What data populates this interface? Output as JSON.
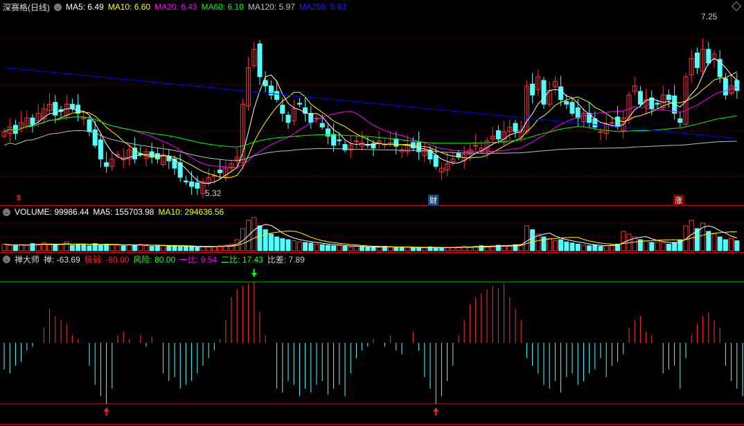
{
  "header": {
    "title": "深赛格(日线)",
    "ma5": "MA5: 6.49",
    "ma10": "MA10: 6.60",
    "ma20": "MA20: 6.43",
    "ma60": "MA60: 6.10",
    "ma120": "MA120: 5.97",
    "ma250": "MA250: 5.93"
  },
  "volume_header": {
    "volume": "VOLUME: 99986.44",
    "ma5": "MA5: 155703.98",
    "ma10": "MA10: 294636.56"
  },
  "indicator_header": {
    "name": "禅大师",
    "chan": "禅: -63.69",
    "jiruo": "极弱: -80.00",
    "fengxian": "风险: 80.00",
    "yibi": "一比: 9.54",
    "erbi": "二比: 17.43",
    "bicha": "比差: 7.89"
  },
  "labels": {
    "high": "7.25",
    "low": "5.32",
    "marker_s": "$",
    "marker_cai": "财",
    "marker_zhang": "涨"
  },
  "colors": {
    "up": "#ff3232",
    "down": "#54fcfc",
    "ma5": "#ffffff",
    "ma10": "#ffff00",
    "ma20": "#ff00ff",
    "ma60": "#00ff00",
    "ma120": "#c0c0c0",
    "ma250": "#0000ff"
  },
  "chart_data": {
    "type": "candlestick",
    "close": [
      6.0,
      6.05,
      5.98,
      6.1,
      6.15,
      6.08,
      6.2,
      6.25,
      6.3,
      6.18,
      6.22,
      6.3,
      6.25,
      6.2,
      6.15,
      6.0,
      5.85,
      5.7,
      5.62,
      5.7,
      5.75,
      5.72,
      5.8,
      5.7,
      5.75,
      5.78,
      5.72,
      5.7,
      5.75,
      5.68,
      5.6,
      5.5,
      5.45,
      5.4,
      5.38,
      5.45,
      5.5,
      5.52,
      5.55,
      5.6,
      5.65,
      5.72,
      6.3,
      6.7,
      6.9,
      6.6,
      6.5,
      6.4,
      6.35,
      6.2,
      6.1,
      6.25,
      6.3,
      6.2,
      6.1,
      6.15,
      6.05,
      5.95,
      5.85,
      5.9,
      5.8,
      5.85,
      5.9,
      5.88,
      5.85,
      5.82,
      5.9,
      5.86,
      5.88,
      5.84,
      5.8,
      5.86,
      5.82,
      5.78,
      5.8,
      5.7,
      5.62,
      5.6,
      5.65,
      5.7,
      5.72,
      5.75,
      5.8,
      5.85,
      5.82,
      5.9,
      5.95,
      5.92,
      6.0,
      6.05,
      6.0,
      6.02,
      6.5,
      6.4,
      6.6,
      6.3,
      6.45,
      6.55,
      6.35,
      6.3,
      6.2,
      6.15,
      6.2,
      6.1,
      6.05,
      6.0,
      6.08,
      6.1,
      6.05,
      6.15,
      6.4,
      6.5,
      6.3,
      6.35,
      6.25,
      6.3,
      6.4,
      6.35,
      6.2,
      6.1,
      6.6,
      6.8,
      6.7,
      6.9,
      6.75,
      6.85,
      6.6,
      6.4,
      6.5,
      6.45
    ],
    "volume": [
      12,
      10,
      9,
      11,
      10,
      13,
      12,
      14,
      11,
      10,
      12,
      16,
      10,
      12,
      11,
      9,
      13,
      10,
      12,
      11,
      10,
      9,
      11,
      10,
      12,
      9,
      8,
      10,
      9,
      8,
      9,
      7,
      8,
      7,
      6,
      8,
      7,
      8,
      9,
      10,
      12,
      20,
      40,
      55,
      60,
      45,
      38,
      30,
      25,
      22,
      20,
      18,
      16,
      15,
      14,
      12,
      11,
      10,
      9,
      10,
      8,
      7,
      8,
      7,
      6,
      7,
      6,
      8,
      7,
      6,
      7,
      6,
      5,
      6,
      5,
      7,
      6,
      5,
      6,
      6,
      7,
      8,
      7,
      8,
      9,
      8,
      9,
      10,
      9,
      10,
      11,
      12,
      45,
      38,
      30,
      25,
      22,
      18,
      20,
      16,
      14,
      12,
      10,
      9,
      10,
      8,
      9,
      10,
      12,
      35,
      30,
      25,
      20,
      18,
      15,
      16,
      14,
      12,
      15,
      20,
      45,
      55,
      40,
      50,
      35,
      30,
      25,
      20,
      22,
      18
    ],
    "indicator": [
      -35,
      -40,
      -30,
      -25,
      -10,
      -5,
      0,
      20,
      45,
      35,
      30,
      25,
      10,
      5,
      0,
      -30,
      -55,
      -70,
      -80,
      -60,
      10,
      15,
      5,
      0,
      10,
      -5,
      8,
      0,
      -40,
      -50,
      -45,
      -60,
      -55,
      -50,
      -40,
      -30,
      -20,
      -10,
      5,
      30,
      60,
      70,
      75,
      78,
      80,
      40,
      10,
      0,
      -60,
      -65,
      -50,
      -55,
      -70,
      -60,
      -65,
      -55,
      -50,
      -68,
      -60,
      -55,
      -70,
      -40,
      -20,
      -10,
      -5,
      5,
      0,
      -5,
      10,
      -10,
      -15,
      0,
      15,
      -10,
      -45,
      -60,
      -80,
      -70,
      -50,
      -30,
      10,
      30,
      50,
      60,
      65,
      70,
      75,
      72,
      78,
      60,
      45,
      30,
      -20,
      -30,
      -40,
      -55,
      -60,
      -50,
      -65,
      -45,
      -40,
      -55,
      -50,
      -40,
      -35,
      -20,
      -45,
      -30,
      -25,
      -15,
      20,
      30,
      35,
      15,
      10,
      0,
      -40,
      -35,
      -30,
      -60,
      -20,
      10,
      25,
      35,
      40,
      30,
      20,
      -30,
      -50,
      -60,
      -70,
      -65
    ],
    "price_range": [
      5.32,
      7.25
    ]
  }
}
